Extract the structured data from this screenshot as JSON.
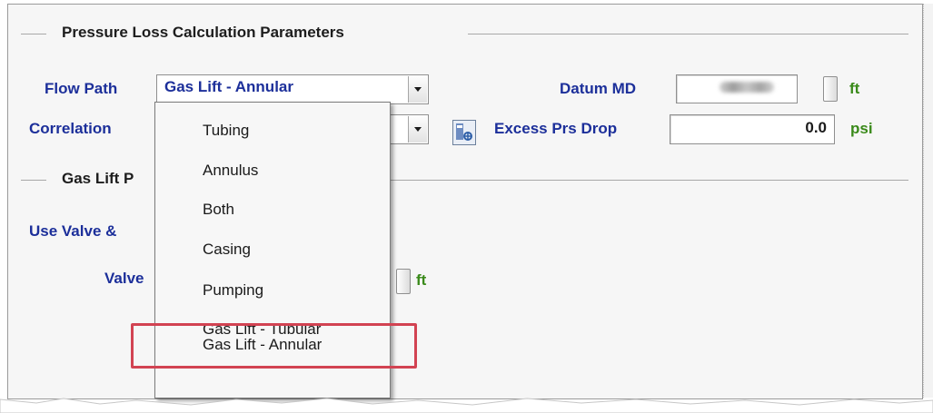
{
  "section1": {
    "title": "Pressure Loss Calculation Parameters"
  },
  "flow_path": {
    "label": "Flow Path",
    "value": "Gas Lift - Annular"
  },
  "datum_md": {
    "label": "Datum MD",
    "unit": "ft"
  },
  "correlation": {
    "label": "Correlation"
  },
  "excess_prs_drop": {
    "label": "Excess Prs Drop",
    "value": "0.0",
    "unit": "psi"
  },
  "section2": {
    "title_visible": "Gas Lift P"
  },
  "use_valve": {
    "label_visible": "Use Valve &"
  },
  "valve": {
    "label_visible": "Valve",
    "unit": "ft"
  },
  "dropdown": {
    "items": [
      "Tubing",
      "Annulus",
      "Both",
      "Casing",
      "Pumping",
      "Gas Lift - Tubular",
      "Gas Lift - Annular"
    ],
    "selected": "Gas Lift - Annular"
  },
  "colors": {
    "label_blue": "#1c2f9a",
    "unit_green": "#3a8a1a",
    "highlight_red": "#d24352"
  },
  "icons": {
    "calc": "calculator-icon",
    "dropdown_arrow": "chevron-down-icon"
  }
}
